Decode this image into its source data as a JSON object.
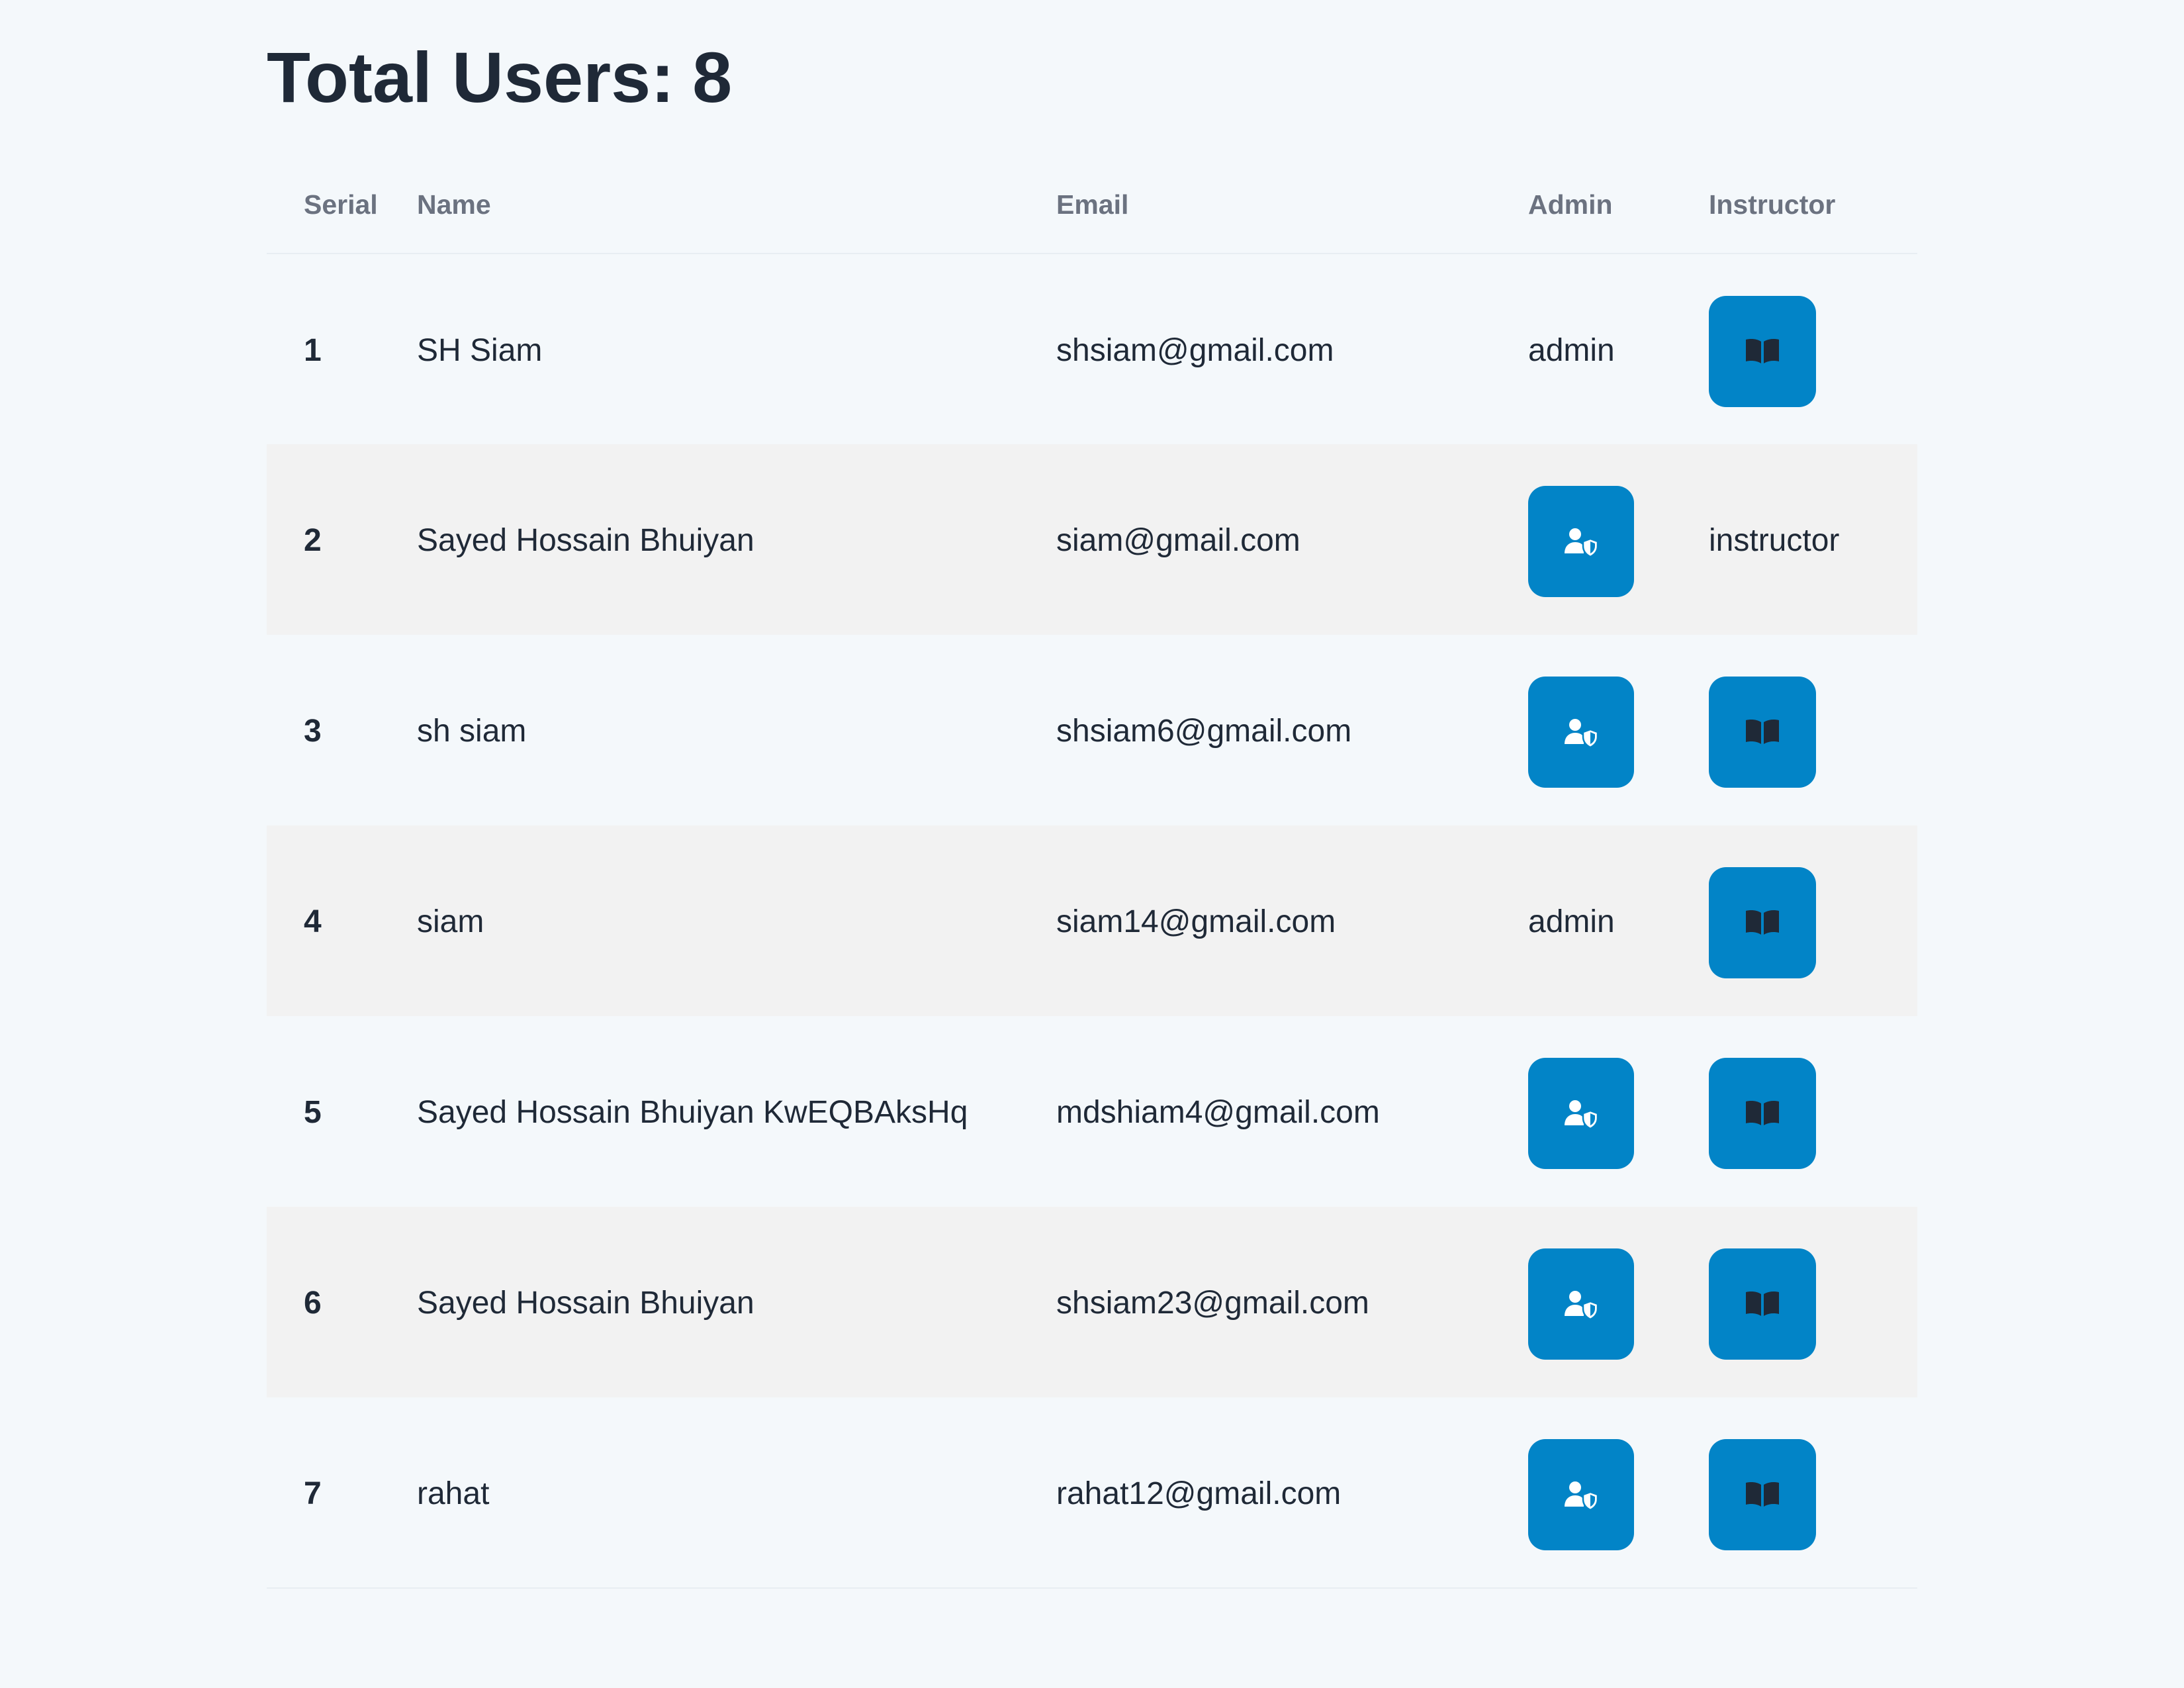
{
  "header": {
    "title_label": "Total Users:",
    "total_count": "8"
  },
  "table": {
    "columns": [
      "Serial",
      "Name",
      "Email",
      "Admin",
      "Instructor"
    ],
    "rows": [
      {
        "serial": "1",
        "name": "SH Siam",
        "email": "shsiam@gmail.com",
        "admin": "admin",
        "instructor": null
      },
      {
        "serial": "2",
        "name": "Sayed Hossain Bhuiyan",
        "email": "siam@gmail.com",
        "admin": null,
        "instructor": "instructor"
      },
      {
        "serial": "3",
        "name": "sh siam",
        "email": "shsiam6@gmail.com",
        "admin": null,
        "instructor": null
      },
      {
        "serial": "4",
        "name": "siam",
        "email": "siam14@gmail.com",
        "admin": "admin",
        "instructor": null
      },
      {
        "serial": "5",
        "name": "Sayed Hossain Bhuiyan KwEQBAksHq",
        "email": "mdshiam4@gmail.com",
        "admin": null,
        "instructor": null
      },
      {
        "serial": "6",
        "name": "Sayed Hossain Bhuiyan",
        "email": "shsiam23@gmail.com",
        "admin": null,
        "instructor": null
      },
      {
        "serial": "7",
        "name": "rahat",
        "email": "rahat12@gmail.com",
        "admin": null,
        "instructor": null
      }
    ]
  },
  "icons": {
    "admin_button": "user-shield-icon",
    "instructor_button": "book-open-icon"
  },
  "colors": {
    "button_bg": "#0284c7",
    "stripe_bg": "#f2f2f2",
    "page_bg": "#f4f8fb",
    "text": "#1f2937",
    "header_text": "#6b7280"
  }
}
